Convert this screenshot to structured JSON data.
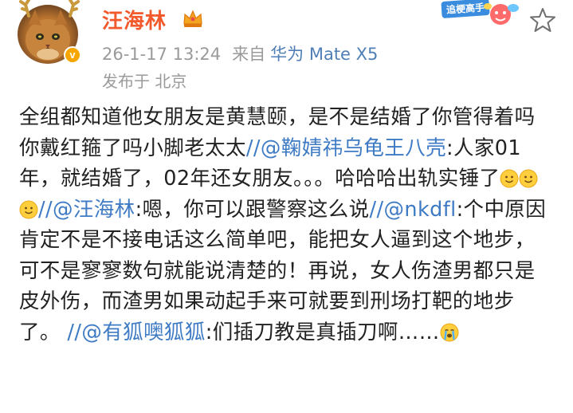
{
  "post": {
    "author": {
      "name": "汪海林",
      "verified_color": "#f7a600",
      "name_color": "#f2592c",
      "avatar_icon": "cat-avatar-icon",
      "badge_icon": "crown-icon"
    },
    "timestamp": "26-1-17 13:24",
    "source_prefix": "来自",
    "source_device": "华为 Mate X5",
    "location": "发布于 北京",
    "promo_label": "追梗高手",
    "favorite_icon": "star-icon"
  },
  "content": {
    "p1": "全组都知道他女朋友是黄慧颐，是不是结婚了你管得着吗你戴红箍了吗小脚老太太",
    "sep": "//",
    "m1": "@鞠婧祎乌龟王八壳",
    "p2": ":人家01年，就结婚了，02年还女朋友。。。哈哈哈出轨实锤了",
    "m2": "@汪海林",
    "p3": ":嗯，你可以跟警察这么说",
    "m3": "@nkdfl",
    "p4": ":个中原因肯定不是不接电话这么简单吧，能把女人逼到这个地步，可不是寥寥数句就能说清楚的！再说，女人伤渣男都只是皮外伤，而渣男如果动起手来可就要到刑场打靶的地步了。",
    "m4": "@有狐噢狐狐",
    "p5": ":们插刀教是真插刀啊……",
    "emoji_p2": [
      "smile-emoji-icon",
      "smile-emoji-icon",
      "smile-emoji-icon"
    ],
    "emoji_end": "crying-emoji-icon",
    "mention_color": "#3f7bc4"
  }
}
